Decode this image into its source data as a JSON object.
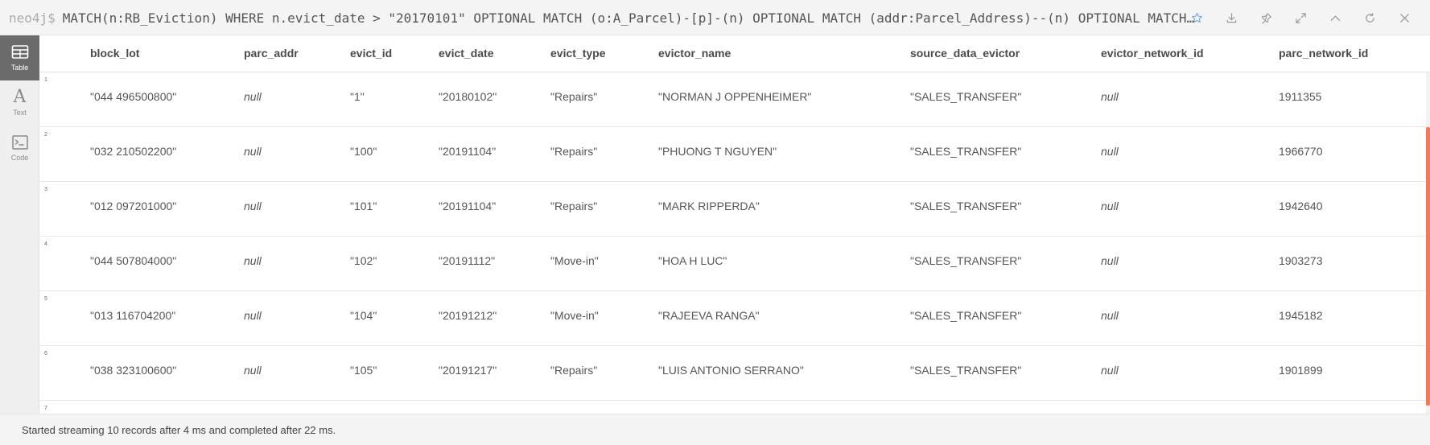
{
  "query": {
    "prompt": "neo4j$",
    "text": "MATCH(n:RB_Eviction)  WHERE n.evict_date > \"20170101\" OPTIONAL MATCH (o:A_Parcel)-[p]-(n) OPTIONAL MATCH (addr:Parcel_Address)--(n) OPTIONAL MATCH (n…"
  },
  "actions": [
    {
      "icon": "star-icon",
      "name": "favorite-button"
    },
    {
      "icon": "download-icon",
      "name": "download-button"
    },
    {
      "icon": "pin-icon",
      "name": "pin-button"
    },
    {
      "icon": "expand-icon",
      "name": "fullscreen-button"
    },
    {
      "icon": "chevron-up-icon",
      "name": "collapse-button"
    },
    {
      "icon": "refresh-icon",
      "name": "rerun-button"
    },
    {
      "icon": "close-icon",
      "name": "close-button"
    }
  ],
  "sidebar": {
    "tabs": [
      {
        "label": "Table",
        "icon": "table-icon",
        "active": true
      },
      {
        "label": "Text",
        "icon": "text-icon",
        "active": false
      },
      {
        "label": "Code",
        "icon": "code-icon",
        "active": false
      }
    ]
  },
  "table": {
    "columns": [
      "block_lot",
      "parc_addr",
      "evict_id",
      "evict_date",
      "evict_type",
      "evictor_name",
      "source_data_evictor",
      "evictor_network_id",
      "parc_network_id"
    ],
    "rows": [
      {
        "index": "1",
        "cells": [
          "\"044 496500800\"",
          "null",
          "\"1\"",
          "\"20180102\"",
          "\"Repairs\"",
          "\"NORMAN J OPPENHEIMER\"",
          "\"SALES_TRANSFER\"",
          "null",
          "1911355"
        ]
      },
      {
        "index": "2",
        "cells": [
          "\"032 210502200\"",
          "null",
          "\"100\"",
          "\"20191104\"",
          "\"Repairs\"",
          "\"PHUONG T NGUYEN\"",
          "\"SALES_TRANSFER\"",
          "null",
          "1966770"
        ]
      },
      {
        "index": "3",
        "cells": [
          "\"012 097201000\"",
          "null",
          "\"101\"",
          "\"20191104\"",
          "\"Repairs\"",
          "\"MARK RIPPERDA\"",
          "\"SALES_TRANSFER\"",
          "null",
          "1942640"
        ]
      },
      {
        "index": "4",
        "cells": [
          "\"044 507804000\"",
          "null",
          "\"102\"",
          "\"20191112\"",
          "\"Move-in\"",
          "\"HOA H LUC\"",
          "\"SALES_TRANSFER\"",
          "null",
          "1903273"
        ]
      },
      {
        "index": "5",
        "cells": [
          "\"013 116704200\"",
          "null",
          "\"104\"",
          "\"20191212\"",
          "\"Move-in\"",
          "\"RAJEEVA RANGA\"",
          "\"SALES_TRANSFER\"",
          "null",
          "1945182"
        ]
      },
      {
        "index": "6",
        "cells": [
          "\"038 323100600\"",
          "null",
          "\"105\"",
          "\"20191217\"",
          "\"Repairs\"",
          "\"LUIS ANTONIO SERRANO\"",
          "\"SALES_TRANSFER\"",
          "null",
          "1901899"
        ]
      },
      {
        "index": "7",
        "cells": []
      }
    ]
  },
  "status": {
    "text": "Started streaming 10 records after 4 ms and completed after 22 ms."
  },
  "colors": {
    "scrollbar_accent": "#f47a54",
    "active_tab": "#6b6b6b"
  }
}
